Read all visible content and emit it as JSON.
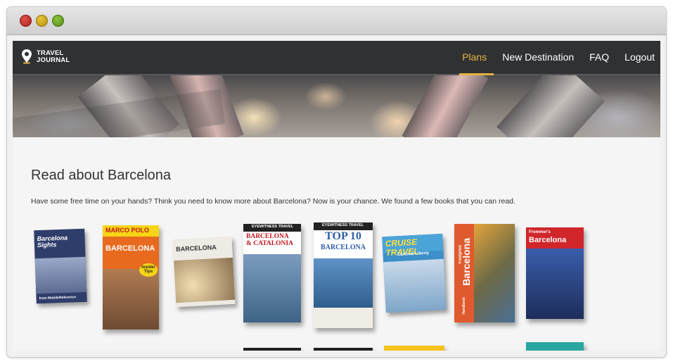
{
  "app": {
    "logo_line1": "TRAVEL",
    "logo_line2": "JOURNAL"
  },
  "nav": {
    "items": [
      "Plans",
      "New Destination",
      "FAQ",
      "Logout"
    ],
    "active": "Plans"
  },
  "main": {
    "title": "Read about Barcelona",
    "intro": "Have some free time on your hands? Think you need to know more about Barcelona? Now is your chance. We found a few books that you can read."
  },
  "books": [
    {
      "cover_text": [
        "Barcelona",
        "Sights",
        "from MobileReference"
      ]
    },
    {
      "cover_text": [
        "MARCO",
        "POLO",
        "BARCELONA",
        "Insider Tips"
      ]
    },
    {
      "cover_text": [
        "BARCELONA"
      ]
    },
    {
      "cover_text": [
        "EYEWITNESS TRAVEL",
        "BARCELONA",
        "& CATALONIA"
      ]
    },
    {
      "cover_text": [
        "EYEWITNESS TRAVEL",
        "TOP 10",
        "BARCELONA"
      ]
    },
    {
      "cover_text": [
        "CRUISE TRAVEL",
        "Carnival Liberty"
      ]
    },
    {
      "cover_text": [
        "Footprint",
        "Barcelona",
        "Handbook"
      ]
    },
    {
      "cover_text": [
        "Frommer's",
        "Barcelona"
      ]
    }
  ],
  "colors": {
    "accent": "#e3b341",
    "navbar": "#2f3133",
    "text": "#333333",
    "content_bg": "#f5f5f5"
  },
  "icons": {
    "logo": "map-pin-icon",
    "window_close": "close-dot-icon",
    "window_minimize": "minimize-dot-icon",
    "window_zoom": "zoom-dot-icon"
  }
}
